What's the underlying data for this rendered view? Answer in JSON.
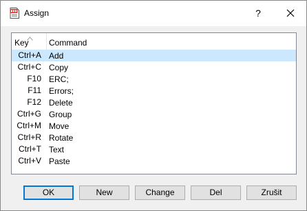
{
  "window": {
    "title": "Assign",
    "help_label": "?",
    "app_icon": "document-app-icon",
    "close_icon": "close-icon"
  },
  "list": {
    "columns": {
      "key": "Key",
      "command": "Command"
    },
    "sort_icon": "sort-up-arrow-icon",
    "rows": [
      {
        "key": "Ctrl+A",
        "command": "Add",
        "selected": true
      },
      {
        "key": "Ctrl+C",
        "command": "Copy"
      },
      {
        "key": "F10",
        "command": "ERC;"
      },
      {
        "key": "F11",
        "command": "Errors;"
      },
      {
        "key": "F12",
        "command": "Delete"
      },
      {
        "key": "Ctrl+G",
        "command": "Group"
      },
      {
        "key": "Ctrl+M",
        "command": "Move"
      },
      {
        "key": "Ctrl+R",
        "command": "Rotate"
      },
      {
        "key": "Ctrl+T",
        "command": "Text"
      },
      {
        "key": "Ctrl+V",
        "command": "Paste"
      }
    ]
  },
  "buttons": {
    "ok": "OK",
    "new": "New",
    "change": "Change",
    "del": "Del",
    "cancel": "Zrušit"
  },
  "colors": {
    "selection": "#cce8ff",
    "default_border": "#0078d7"
  }
}
